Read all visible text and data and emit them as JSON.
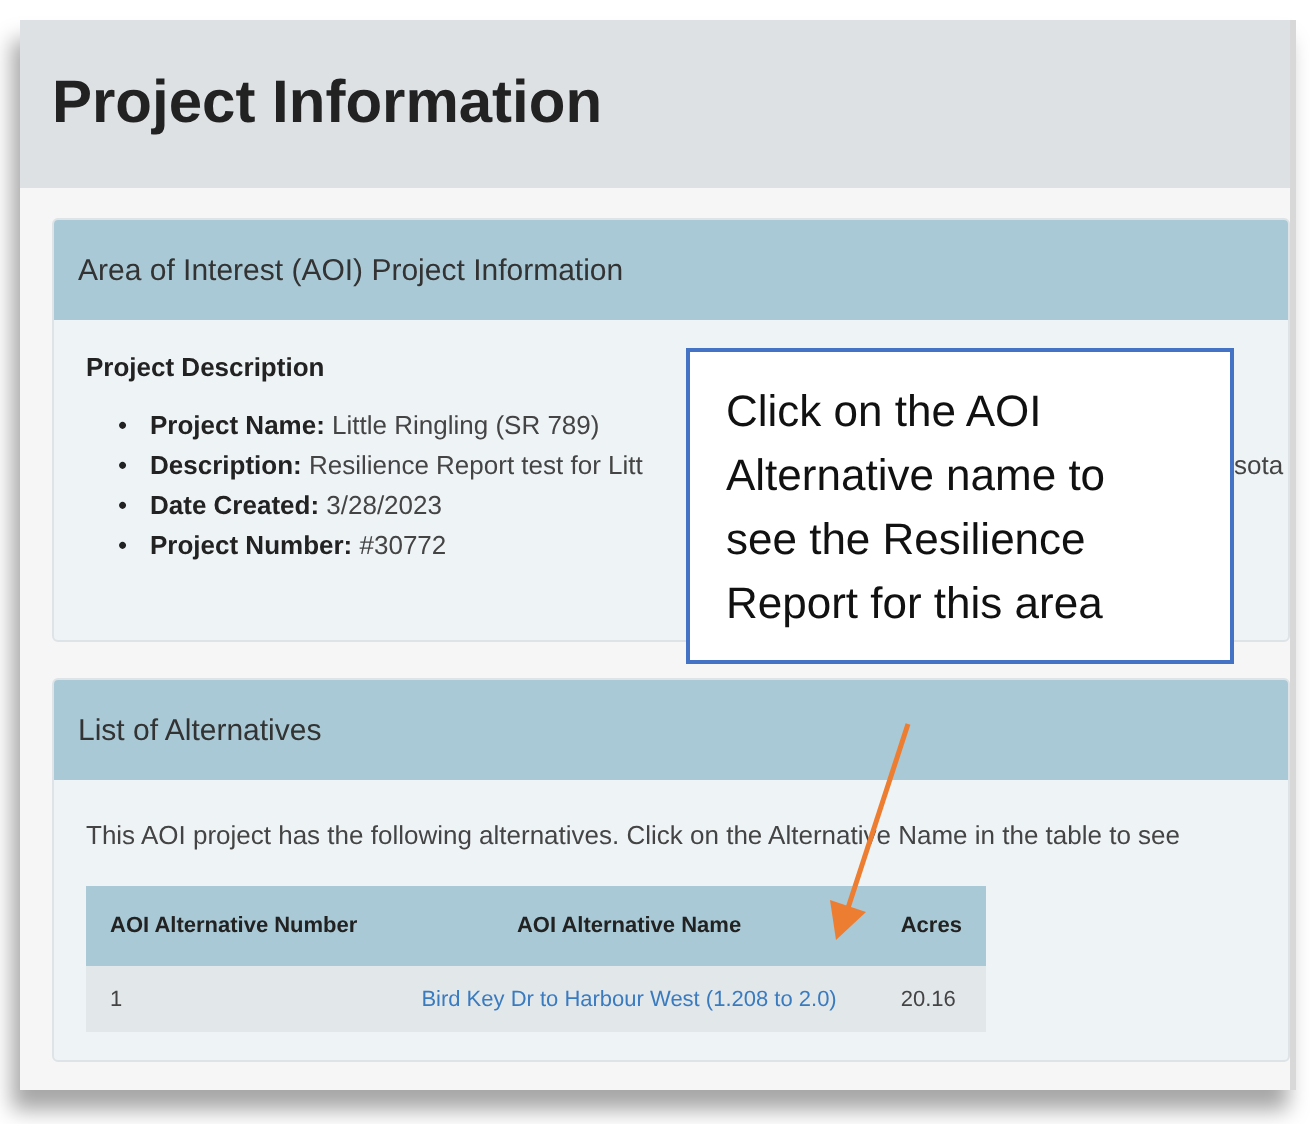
{
  "page": {
    "title": "Project Information"
  },
  "aoi_card": {
    "title": "Area of Interest (AOI) Project Information",
    "section_heading": "Project Description",
    "items": [
      {
        "bullet": "•",
        "label": "Project Name:",
        "value": "Little Ringling (SR 789)"
      },
      {
        "bullet": "•",
        "label": "Description:",
        "value": "Resilience Report test for Litt",
        "value_tail": "sota"
      },
      {
        "bullet": "•",
        "label": "Date Created:",
        "value": "3/28/2023"
      },
      {
        "bullet": "•",
        "label": "Project Number:",
        "value": "#30772"
      }
    ]
  },
  "alternatives_card": {
    "title": "List of Alternatives",
    "intro": "This AOI project has the following alternatives. Click on the Alternative Name in the table to see",
    "table": {
      "columns": [
        "AOI Alternative Number",
        "AOI Alternative Name",
        "Acres"
      ],
      "rows": [
        {
          "number": "1",
          "name": "Bird Key Dr to Harbour West (1.208 to 2.0)",
          "acres": "20.16"
        }
      ]
    }
  },
  "callout": {
    "text": "Click on the AOI Alternative name to see the Resilience Report for this area"
  }
}
